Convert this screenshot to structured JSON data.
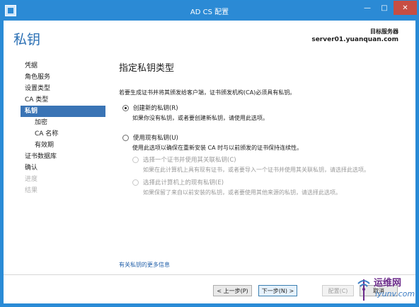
{
  "window": {
    "title": "AD CS 配置",
    "min_symbol": "—",
    "max_symbol": "□",
    "close_symbol": "✕"
  },
  "header": {
    "page_title": "私钥",
    "target_label": "目标服务器",
    "target_value": "server01.yuanquan.com"
  },
  "nav": {
    "items": [
      {
        "label": "凭据",
        "state": "normal"
      },
      {
        "label": "角色服务",
        "state": "normal"
      },
      {
        "label": "设置类型",
        "state": "normal"
      },
      {
        "label": "CA 类型",
        "state": "normal"
      },
      {
        "label": "私钥",
        "state": "active"
      },
      {
        "label": "加密",
        "state": "sub"
      },
      {
        "label": "CA 名称",
        "state": "sub"
      },
      {
        "label": "有效期",
        "state": "sub"
      },
      {
        "label": "证书数据库",
        "state": "normal"
      },
      {
        "label": "确认",
        "state": "normal"
      },
      {
        "label": "进度",
        "state": "disabled"
      },
      {
        "label": "结果",
        "state": "disabled"
      }
    ]
  },
  "content": {
    "section_title": "指定私钥类型",
    "description": "若要生成证书并将其颁发给客户端，证书颁发机构(CA)必须具有私钥。",
    "option_new": {
      "label": "创建新的私钥(R)",
      "note": "如果你没有私钥，或者要创建新私钥，请使用此选项。",
      "checked": true
    },
    "option_existing": {
      "label": "使用现有私钥(U)",
      "note": "使用此选项以确保在重新安装 CA 时与以前颁发的证书保持连续性。",
      "checked": false
    },
    "sub_option_cert": {
      "label": "选择一个证书并使用其关联私钥(C)",
      "note": "如果在此计算机上具有现有证书，或者要导入一个证书并使用其关联私钥，请选择此选项。"
    },
    "sub_option_key": {
      "label": "选择此计算机上的现有私钥(E)",
      "note": "如果保留了来自以前安装的私钥，或者要使用其他来源的私钥，请选择此选项。"
    },
    "more_link": "有关私钥的更多信息"
  },
  "footer": {
    "prev": "< 上一步(P)",
    "next": "下一步(N) >",
    "configure": "配置(C)",
    "cancel": "取消"
  },
  "watermark": {
    "cn": "运维网",
    "en": "iyunv.com"
  },
  "colors": {
    "titlebar": "#2b8ad5",
    "nav_active": "#3a74b5",
    "page_title": "#2a6fb4",
    "link": "#1f5ea8"
  }
}
